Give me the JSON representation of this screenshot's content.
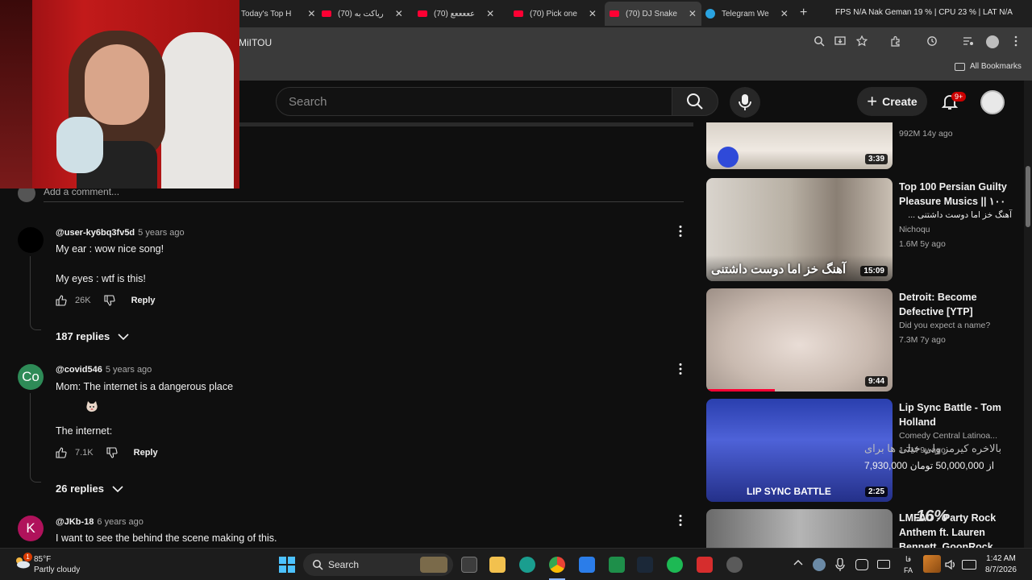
{
  "browser": {
    "tabs": [
      {
        "label": "Today's Top H",
        "icon": "page-icon"
      },
      {
        "label": "(70) ریاکت به",
        "icon": "youtube-icon"
      },
      {
        "label": "(70) عععععع",
        "icon": "youtube-icon"
      },
      {
        "label": "(70) Pick one",
        "icon": "youtube-icon"
      },
      {
        "label": "(70) DJ Snake",
        "icon": "youtube-icon",
        "active": true
      },
      {
        "label": "Telegram We",
        "icon": "telegram-icon"
      }
    ],
    "tab_close": "✕",
    "new_tab": "+",
    "perf_stats": "FPS N/A  Nak Geman 19 %  |  CPU 23 %  |  LAT  N/A",
    "url": "MiITOU",
    "bookmarks_label": "All Bookmarks"
  },
  "youtube": {
    "search_placeholder": "Search",
    "create_label": "Create",
    "notifications_badge": "9+"
  },
  "comments": {
    "add_placeholder": "Add a comment...",
    "items": [
      {
        "user": "@user-ky6bq3fv5d",
        "time": "5 years ago",
        "lines": [
          "My ear : wow nice song!",
          "My eyes : wtf is this!"
        ],
        "likes": "26K",
        "reply": "Reply",
        "replies": "187 replies",
        "avatar_text": "",
        "avatar_color": "#000000"
      },
      {
        "user": "@covid546",
        "time": "5 years ago",
        "lines": [
          "Mom: The internet is a dangerous place",
          "The internet:"
        ],
        "likes": "7.1K",
        "reply": "Reply",
        "replies": "26 replies",
        "avatar_text": "Co",
        "avatar_color": "#2e8b57"
      },
      {
        "user": "@JKb-18",
        "time": "6 years ago",
        "lines": [
          "I want to see the behind the scene making of this."
        ],
        "avatar_text": "K",
        "avatar_color": "#b0125b"
      }
    ]
  },
  "recommendations": [
    {
      "title": "",
      "channel": "",
      "meta": "992M  14y ago",
      "duration": "3:39"
    },
    {
      "title": "Top 100 Persian Guilty Pleasure Musics || ۱۰۰",
      "subtitle": "آهنگ خز اما دوست داشتنی ...",
      "channel": "Nichoqu",
      "meta": "1.6M  5y ago",
      "duration": "15:09",
      "thumb_text": "آهنگ خز اما دوست داشتنی"
    },
    {
      "title": "Detroit: Become Defective [YTP]",
      "channel": "Did you expect a name?",
      "meta": "7.3M  7y ago",
      "duration": "9:44"
    },
    {
      "title": "Lip Sync Battle - Tom Holland",
      "channel": "Comedy Central Latinoa...",
      "meta": "1.7M  9y ago",
      "duration": "2:25",
      "thumb_text": "LIP SYNC BATTLE"
    },
    {
      "title": "LMFAO - Party Rock Anthem ft. Lauren Bennett, GoonRock",
      "channel": "",
      "meta": "",
      "duration": ""
    }
  ],
  "overlay": {
    "donation_line": "بالاخره کیرمز ولی خیلی ها برای",
    "donation_amount": "7,930,000 از 50,000,000 تومان",
    "percent": "16%"
  },
  "taskbar": {
    "temp": "85°F",
    "weather": "Partly cloudy",
    "weather_badge": "1",
    "search": "Search",
    "lang_top": "فا",
    "lang_bottom": "FA",
    "time": "1:42 AM",
    "date": "8/7/2026"
  },
  "colors": {
    "youtube_red": "#ff0033",
    "notif_red": "#cc0000",
    "page_bg": "#0f0f0f"
  }
}
